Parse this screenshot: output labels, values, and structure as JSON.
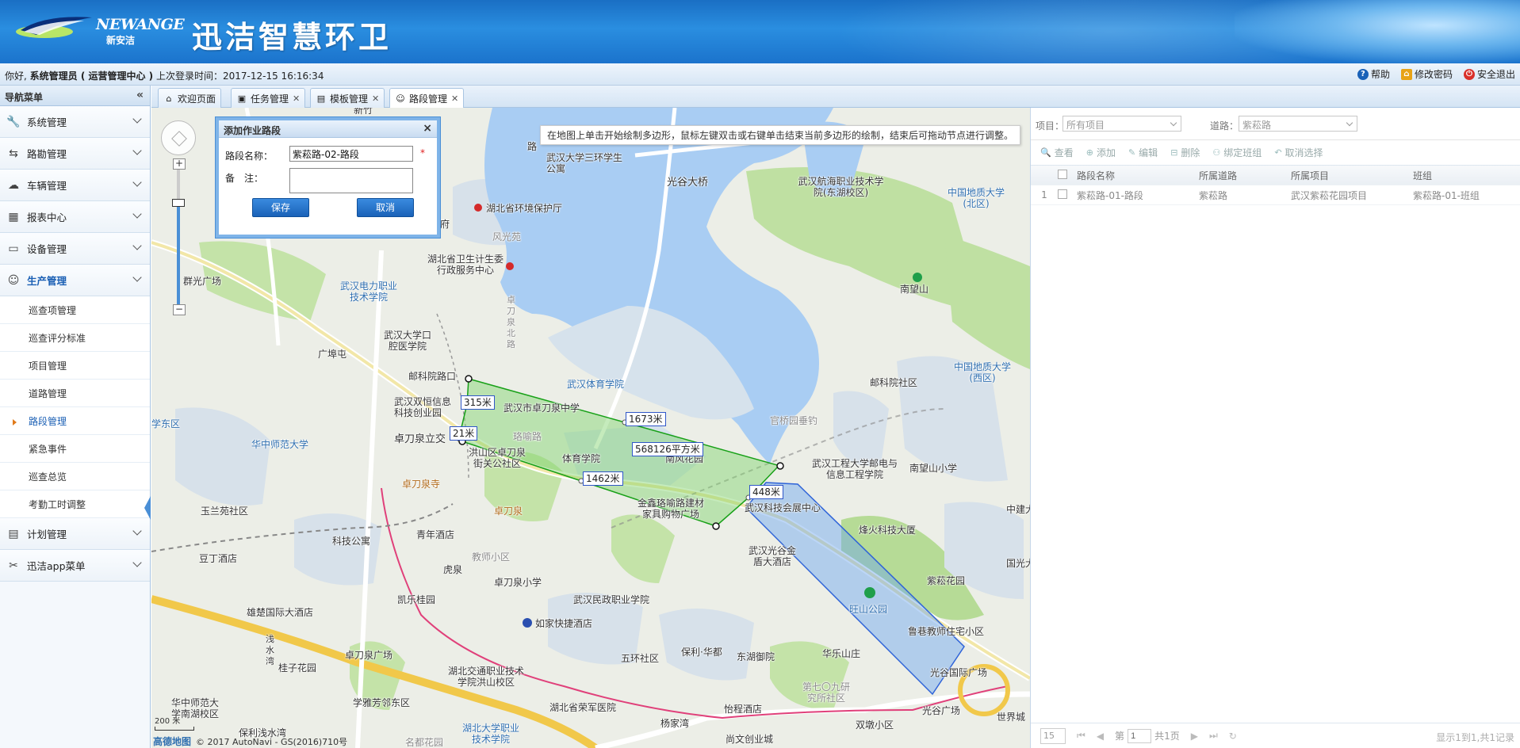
{
  "header": {
    "logo_text": "NEWANGE",
    "logo_sub": "新安洁",
    "title": "迅洁智慧环卫"
  },
  "infobar": {
    "greeting": "你好,",
    "user": "系统管理员 ( 运营管理中心 )",
    "last_login": "上次登录时间：2017-12-15 16:16:34",
    "help": "帮助",
    "change_password": "修改密码",
    "logout": "安全退出"
  },
  "sidebar": {
    "title": "导航菜单",
    "collapse": "«",
    "groups": [
      {
        "label": "系统管理",
        "icon": "wrench-icon"
      },
      {
        "label": "路勘管理",
        "icon": "arrows-icon"
      },
      {
        "label": "车辆管理",
        "icon": "cloud-icon"
      },
      {
        "label": "报表中心",
        "icon": "table-icon"
      },
      {
        "label": "设备管理",
        "icon": "monitor-icon"
      },
      {
        "label": "生产管理",
        "icon": "smile-icon"
      }
    ],
    "sub_items": [
      "巡查项管理",
      "巡查评分标准",
      "项目管理",
      "道路管理",
      "路段管理",
      "紧急事件",
      "巡查总览",
      "考勤工时调整"
    ],
    "active_sub": "路段管理",
    "groups_after": [
      {
        "label": "计划管理",
        "icon": "document-icon"
      },
      {
        "label": "迅洁app菜单",
        "icon": "tools-icon"
      }
    ]
  },
  "tabs": [
    {
      "label": "欢迎页面",
      "closable": false
    },
    {
      "label": "任务管理",
      "closable": true
    },
    {
      "label": "模板管理",
      "closable": true
    },
    {
      "label": "路段管理",
      "closable": true,
      "active": true
    }
  ],
  "map": {
    "hint": "在地图上单击开始绘制多边形，鼠标左键双击或右键单击结束当前多边形的绘制，结束后可拖动节点进行调整。",
    "measurements": [
      "315米",
      "21米",
      "1673米",
      "568126平方米",
      "1462米",
      "448米"
    ],
    "labels": [
      "新竹",
      "路",
      "武汉大学三环学生公寓",
      "光谷大桥",
      "武汉航海职业技术学院(东湖校区)",
      "中国地质大学(北区)",
      "湖北省环境保护厅",
      "府",
      "风光苑",
      "湖北省卫生计生委行政服务中心",
      "南望山",
      "群光广场",
      "武汉电力职业技术学院",
      "武汉大学口腔医学院",
      "广埠屯",
      "卓刀泉北路",
      "武汉体育学院",
      "邮科院社区",
      "中国地质大学(西区)",
      "邮科院路口",
      "武汉双恒信息科技创业园",
      "武汉市卓刀泉中学",
      "官桥园垂钓",
      "学东区",
      "华中师范大学",
      "卓刀泉立交",
      "洪山区卓刀泉街关公社区",
      "体育学院",
      "南风花园",
      "武汉工程大学邮电与信息工程学院",
      "南望山小学",
      "卓刀泉寺",
      "珞喻路",
      "金鑫珞喻路建材家具购物广场",
      "武汉科技会展中心",
      "中建大",
      "玉兰苑社区",
      "卓刀泉",
      "武汉光谷金盾大酒店",
      "烽火科技大厦",
      "科技公寓",
      "青年酒店",
      "国光大",
      "豆丁酒店",
      "虎泉",
      "教师小区",
      "卓刀泉小学",
      "紫菘花园",
      "凯乐桂园",
      "武汉民政职业学院",
      "旺山公园",
      "雄楚国际大酒店",
      "如家快捷酒店",
      "鲁巷教师住宅小区",
      "浅水湾",
      "保利·华都",
      "东湖御院",
      "华乐山庄",
      "光谷国际广场",
      "桂子花园",
      "卓刀泉广场",
      "五环社区",
      "第七〇九研究所社区",
      "华中师范大学南湖校区",
      "湖北交通职业技术学院洪山校区",
      "学雅芳邻东区",
      "湖北省荣军医院",
      "怡程酒店",
      "光谷广场",
      "世界城",
      "保利浅水湾",
      "杨家湾",
      "湖北大学职业技术学院",
      "名都花园",
      "尚文创业城",
      "双墩小区"
    ],
    "scale": "200 米",
    "copyright": "© 2017 AutoNavi - GS(2016)710号",
    "brand": "高德地图",
    "zoom_in": "+",
    "zoom_out": "−"
  },
  "dialog": {
    "title": "添加作业路段",
    "name_label": "路段名称：",
    "name_value": "紫菘路-02-路段",
    "note_label": "备　注：",
    "note_value": "",
    "required_mark": "*",
    "save": "保存",
    "cancel": "取消",
    "close": "×"
  },
  "right_panel": {
    "project_label": "项目：",
    "project_value": "所有项目",
    "road_label": "道路：",
    "road_value": "紫菘路",
    "toolbar": [
      "查看",
      "添加",
      "编辑",
      "删除",
      "绑定班组",
      "取消选择"
    ],
    "columns": [
      "路段名称",
      "所属道路",
      "所属项目",
      "班组"
    ],
    "rows": [
      {
        "index": "1",
        "name": "紫菘路-01-路段",
        "road": "紫菘路",
        "project": "武汉紫菘花园项目",
        "team": "紫菘路-01-班组"
      }
    ],
    "page_size": "15",
    "page_prefix": "第",
    "page_value": "1",
    "page_total": "共1页",
    "summary": "显示1到1,共1记录"
  },
  "colors": {
    "header_blue": "#1b73cc",
    "polygon_green": "#22b022",
    "polygon_blue": "#3f7de8",
    "route": "#e0407a"
  }
}
